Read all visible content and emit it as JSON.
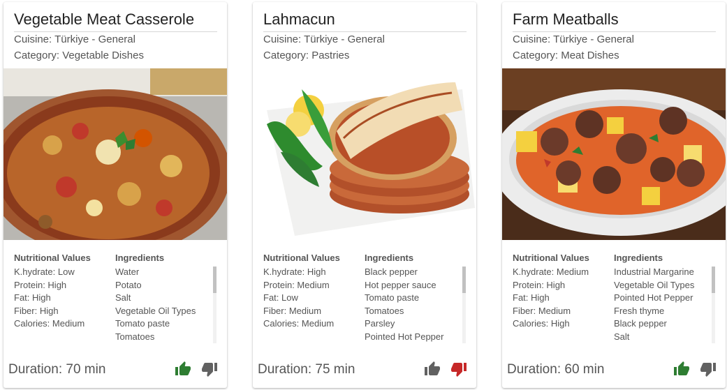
{
  "labels": {
    "nutritional_values": "Nutritional Values",
    "ingredients": "Ingredients"
  },
  "colors": {
    "like_active": "#2e7d32",
    "dislike_active": "#c62828",
    "neutral": "#616161"
  },
  "recipes": [
    {
      "title": "Vegetable Meat Casserole",
      "cuisine": "Cuisine: Türkiye - General",
      "category": "Category: Vegetable Dishes",
      "nutrition": [
        "K.hydrate: Low",
        "Protein: High",
        "Fat: High",
        "Fiber: High",
        "Calories: Medium"
      ],
      "ingredients": [
        "Water",
        "Potato",
        "Salt",
        "Vegetable Oil Types",
        "Tomato paste",
        "Tomatoes"
      ],
      "duration": "Duration: 70 min",
      "liked": true,
      "disliked": false,
      "like_icon": "thumbs-up-icon",
      "dislike_icon": "thumbs-down-icon"
    },
    {
      "title": "Lahmacun",
      "cuisine": "Cuisine: Türkiye - General",
      "category": "Category: Pastries",
      "nutrition": [
        "K.hydrate: High",
        "Protein: Medium",
        "Fat: Low",
        "Fiber: Medium",
        "Calories: Medium"
      ],
      "ingredients": [
        "Black pepper",
        "Hot pepper sauce",
        "Tomato paste",
        "Tomatoes",
        "Parsley",
        "Pointed Hot Pepper"
      ],
      "duration": "Duration: 75 min",
      "liked": false,
      "disliked": true,
      "like_icon": "thumbs-up-icon",
      "dislike_icon": "thumbs-down-icon"
    },
    {
      "title": "Farm Meatballs",
      "cuisine": "Cuisine: Türkiye - General",
      "category": "Category: Meat Dishes",
      "nutrition": [
        "K.hydrate: Medium",
        "Protein: High",
        "Fat: High",
        "Fiber: Medium",
        "Calories: High"
      ],
      "ingredients": [
        "Industrial Margarine",
        "Vegetable Oil Types",
        "Pointed Hot Pepper",
        "Fresh thyme",
        "Black pepper",
        "Salt"
      ],
      "duration": "Duration: 60 min",
      "liked": true,
      "disliked": false,
      "like_icon": "thumbs-up-icon",
      "dislike_icon": "thumbs-down-icon"
    }
  ]
}
